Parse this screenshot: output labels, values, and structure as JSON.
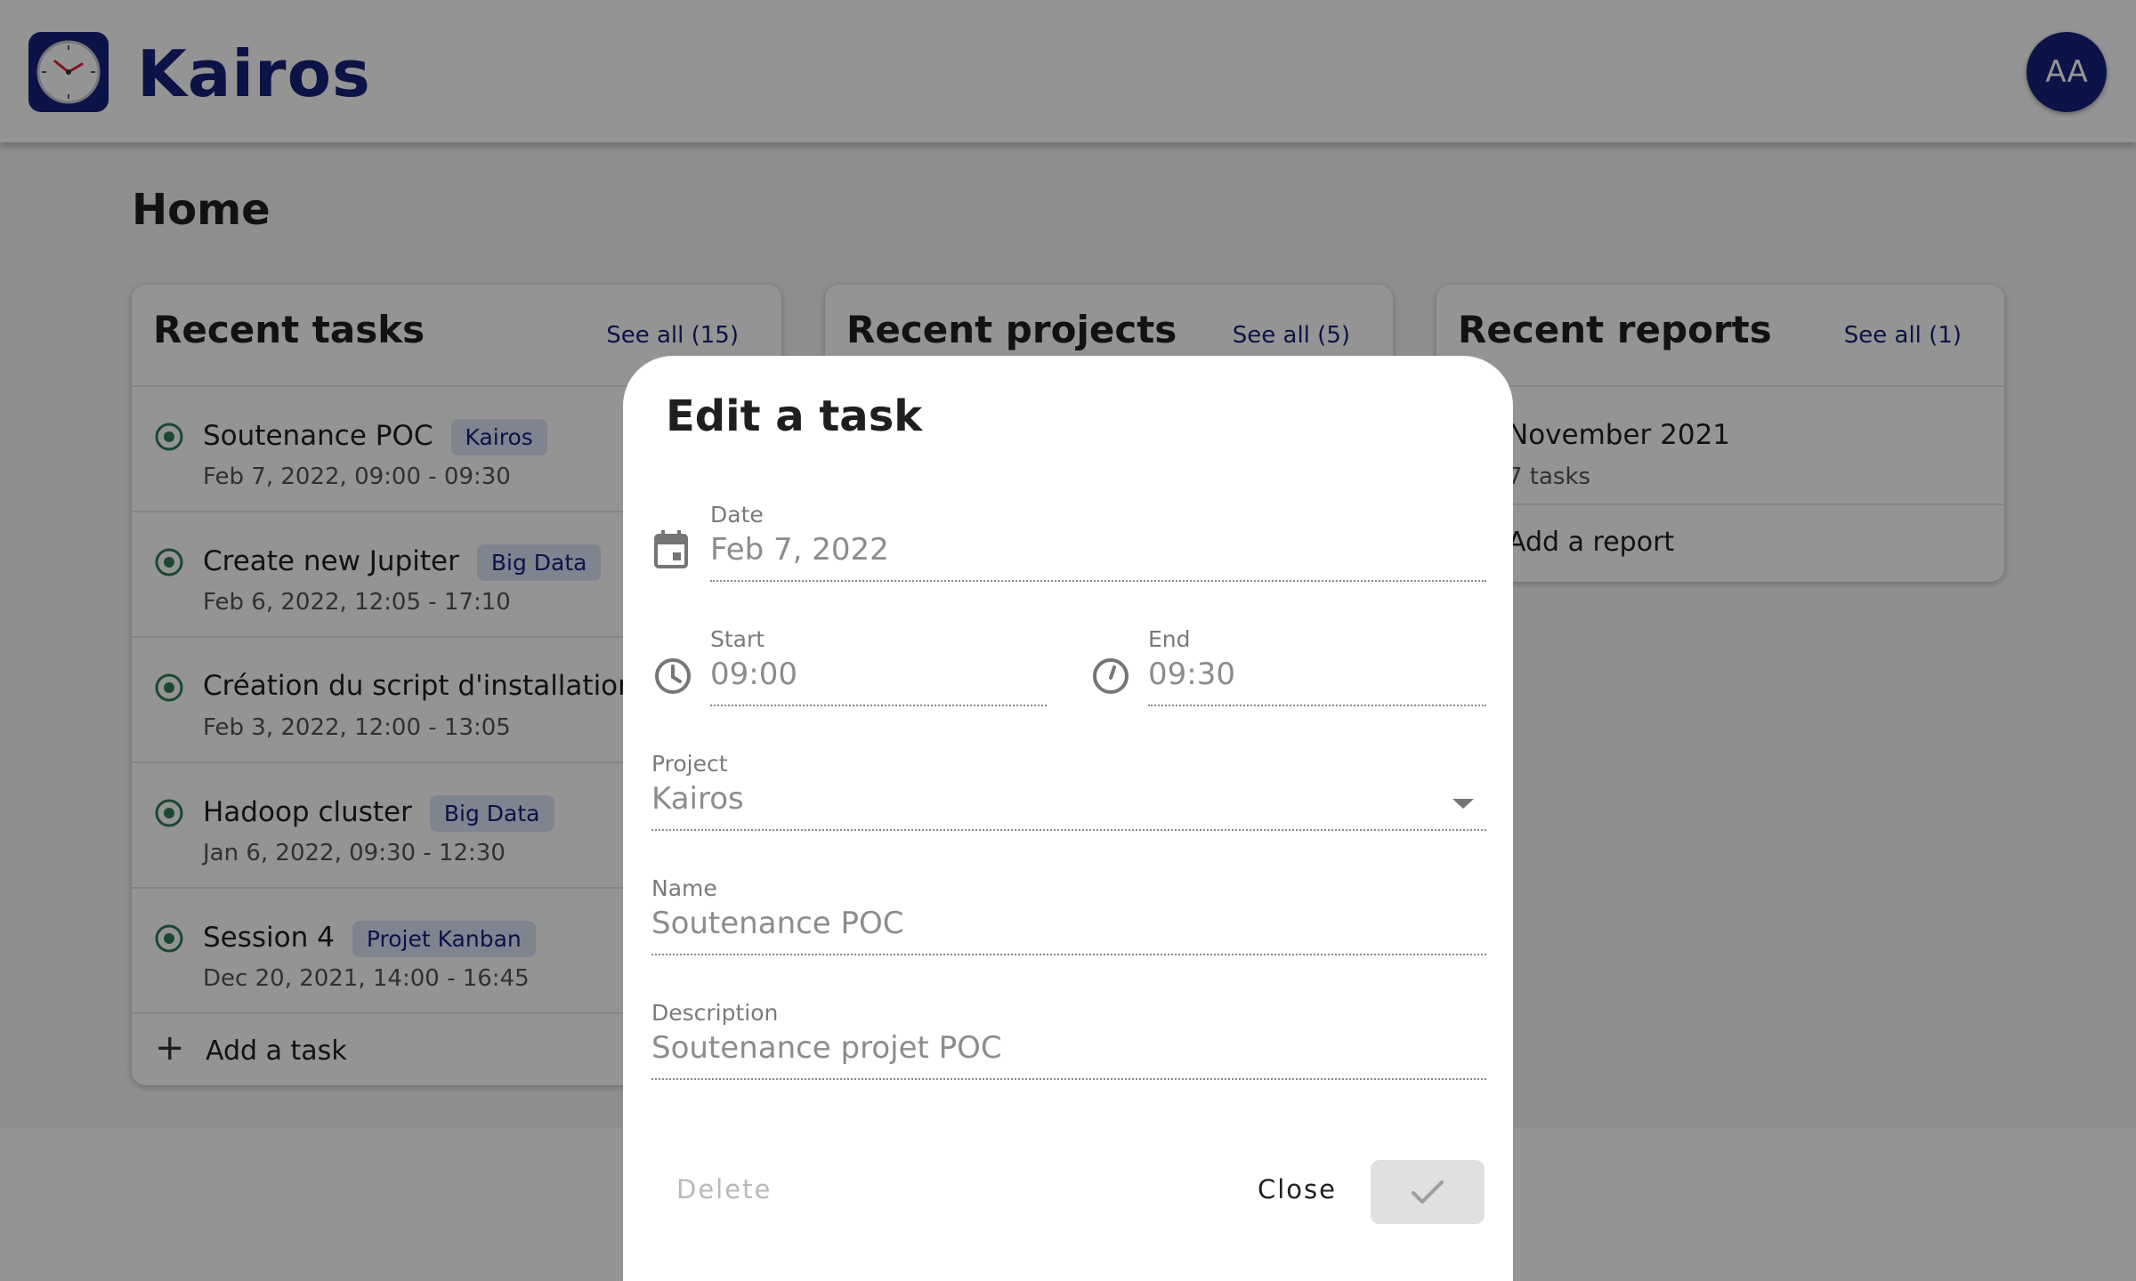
{
  "app": {
    "name": "Kairos",
    "avatar_initials": "AA",
    "accent": "#14227a"
  },
  "page": {
    "title": "Home"
  },
  "tasks_card": {
    "title": "Recent tasks",
    "see_all": "See all (15)",
    "items": [
      {
        "name": "Soutenance POC",
        "tag": "Kairos",
        "time": "Feb 7, 2022, 09:00 - 09:30"
      },
      {
        "name": "Create new Jupiter",
        "tag": "Big Data",
        "time": "Feb 6, 2022, 12:05 - 17:10"
      },
      {
        "name": "Création du script d'installation",
        "tag": "",
        "time": "Feb 3, 2022, 12:00 - 13:05"
      },
      {
        "name": "Hadoop cluster",
        "tag": "Big Data",
        "time": "Jan 6, 2022, 09:30 - 12:30"
      },
      {
        "name": "Session 4",
        "tag": "Projet Kanban",
        "time": "Dec 20, 2021, 14:00 - 16:45"
      }
    ],
    "add_label": "Add a task"
  },
  "projects_card": {
    "title": "Recent projects",
    "see_all": "See all (5)"
  },
  "reports_card": {
    "title": "Recent reports",
    "see_all": "See all (1)",
    "items": [
      {
        "name": "November 2021",
        "sub": "7 tasks"
      }
    ],
    "add_label": "Add a report"
  },
  "dialog": {
    "title": "Edit a task",
    "date": {
      "label": "Date",
      "value": "Feb 7, 2022"
    },
    "start": {
      "label": "Start",
      "value": "09:00"
    },
    "end": {
      "label": "End",
      "value": "09:30"
    },
    "project": {
      "label": "Project",
      "value": "Kairos"
    },
    "name": {
      "label": "Name",
      "value": "Soutenance POC"
    },
    "description": {
      "label": "Description",
      "value": "Soutenance projet POC"
    },
    "delete_label": "Delete",
    "close_label": "Close",
    "confirm_icon": "check-icon"
  }
}
